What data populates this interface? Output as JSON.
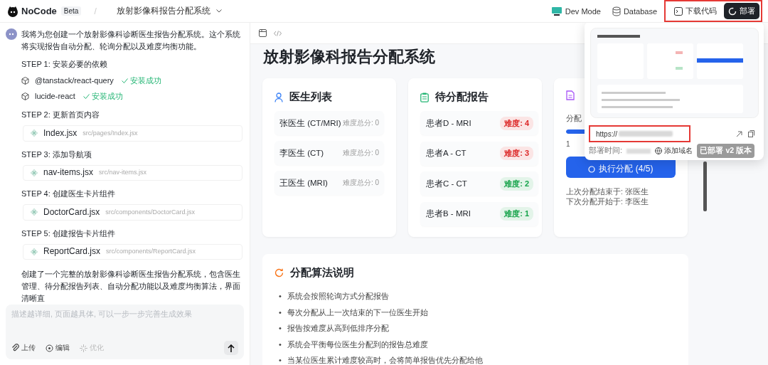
{
  "topbar": {
    "logo": "NoCode",
    "badge": "Beta",
    "separator": "/",
    "project": "放射影像科报告分配系统",
    "actions": [
      {
        "label": "Dev Mode",
        "kind": "devmode"
      },
      {
        "label": "Database",
        "kind": "database"
      }
    ],
    "highlighted_actions": [
      {
        "label": "下载代码",
        "kind": "download"
      },
      {
        "label": "部署",
        "kind": "deploy"
      }
    ]
  },
  "chat": {
    "intro": "我将为您创建一个放射影像科诊断医生报告分配系统。这个系统将实现报告自动分配、轮询分配以及难度均衡功能。",
    "steps": [
      {
        "title": "STEP 1: 安装必要的依赖",
        "items": [
          {
            "kind": "package",
            "name": "@tanstack/react-query",
            "status": "安装成功"
          },
          {
            "kind": "package",
            "name": "lucide-react",
            "status": "安装成功"
          }
        ]
      },
      {
        "title": "STEP 2: 更新首页内容",
        "items": [
          {
            "kind": "file",
            "name": "Index.jsx",
            "path": "src/pages/Index.jsx"
          }
        ]
      },
      {
        "title": "STEP 3: 添加导航项",
        "items": [
          {
            "kind": "file",
            "name": "nav-items.jsx",
            "path": "src/nav-items.jsx"
          }
        ]
      },
      {
        "title": "STEP 4: 创建医生卡片组件",
        "items": [
          {
            "kind": "file",
            "name": "DoctorCard.jsx",
            "path": "src/components/DoctorCard.jsx"
          }
        ]
      },
      {
        "title": "STEP 5: 创建报告卡片组件",
        "items": [
          {
            "kind": "file",
            "name": "ReportCard.jsx",
            "path": "src/components/ReportCard.jsx"
          }
        ]
      }
    ],
    "summary": "创建了一个完整的放射影像科诊断医生报告分配系统，包含医生管理、待分配报告列表、自动分配功能以及难度均衡算法，界面清晰直",
    "input": {
      "placeholder": "描述越详细, 页面越具体, 可以一步一步完善生成效果",
      "tools": [
        {
          "label": "上传",
          "kind": "upload",
          "disabled": false
        },
        {
          "label": "编辑",
          "kind": "edit",
          "disabled": false
        },
        {
          "label": "优化",
          "kind": "optimize",
          "disabled": true
        }
      ]
    }
  },
  "preview": {
    "title": "放射影像科报告分配系统",
    "doctors": {
      "title": "医生列表",
      "rows": [
        {
          "name": "张医生 (CT/MRI)",
          "score": "难度总分: 0"
        },
        {
          "name": "李医生 (CT)",
          "score": "难度总分: 0"
        },
        {
          "name": "王医生 (MRI)",
          "score": "难度总分: 0"
        }
      ]
    },
    "reports": {
      "title": "待分配报告",
      "rows": [
        {
          "name": "患者D - MRI",
          "badge": "难度: 4",
          "color": "#dc2626"
        },
        {
          "name": "患者A - CT",
          "badge": "难度: 3",
          "color": "#dc2626"
        },
        {
          "name": "患者C - CT",
          "badge": "难度: 2",
          "color": "#16a34a"
        },
        {
          "name": "患者B - MRI",
          "badge": "难度: 1",
          "color": "#16a34a"
        }
      ]
    },
    "allocation": {
      "label": "分配",
      "level": 0.2,
      "progress_text": "1",
      "button": "执行分配 (4/5)",
      "notes": [
        "上次分配结束于: 张医生",
        "下次分配开始于: 李医生"
      ]
    },
    "algorithm": {
      "title": "分配算法说明",
      "marker": "•",
      "bullets": [
        "系统会按照轮询方式分配报告",
        "每次分配从上一次结束的下一位医生开始",
        "报告按难度从高到低排序分配",
        "系统会平衡每位医生分配到的报告总难度",
        "当某位医生累计难度较高时，会将简单报告优先分配给他"
      ]
    }
  },
  "deploy_popup": {
    "url": "https://",
    "url_highlighted": true,
    "time_label": "部署时间:",
    "add_domain": "添加域名",
    "version": "已部署 v2 版本"
  }
}
